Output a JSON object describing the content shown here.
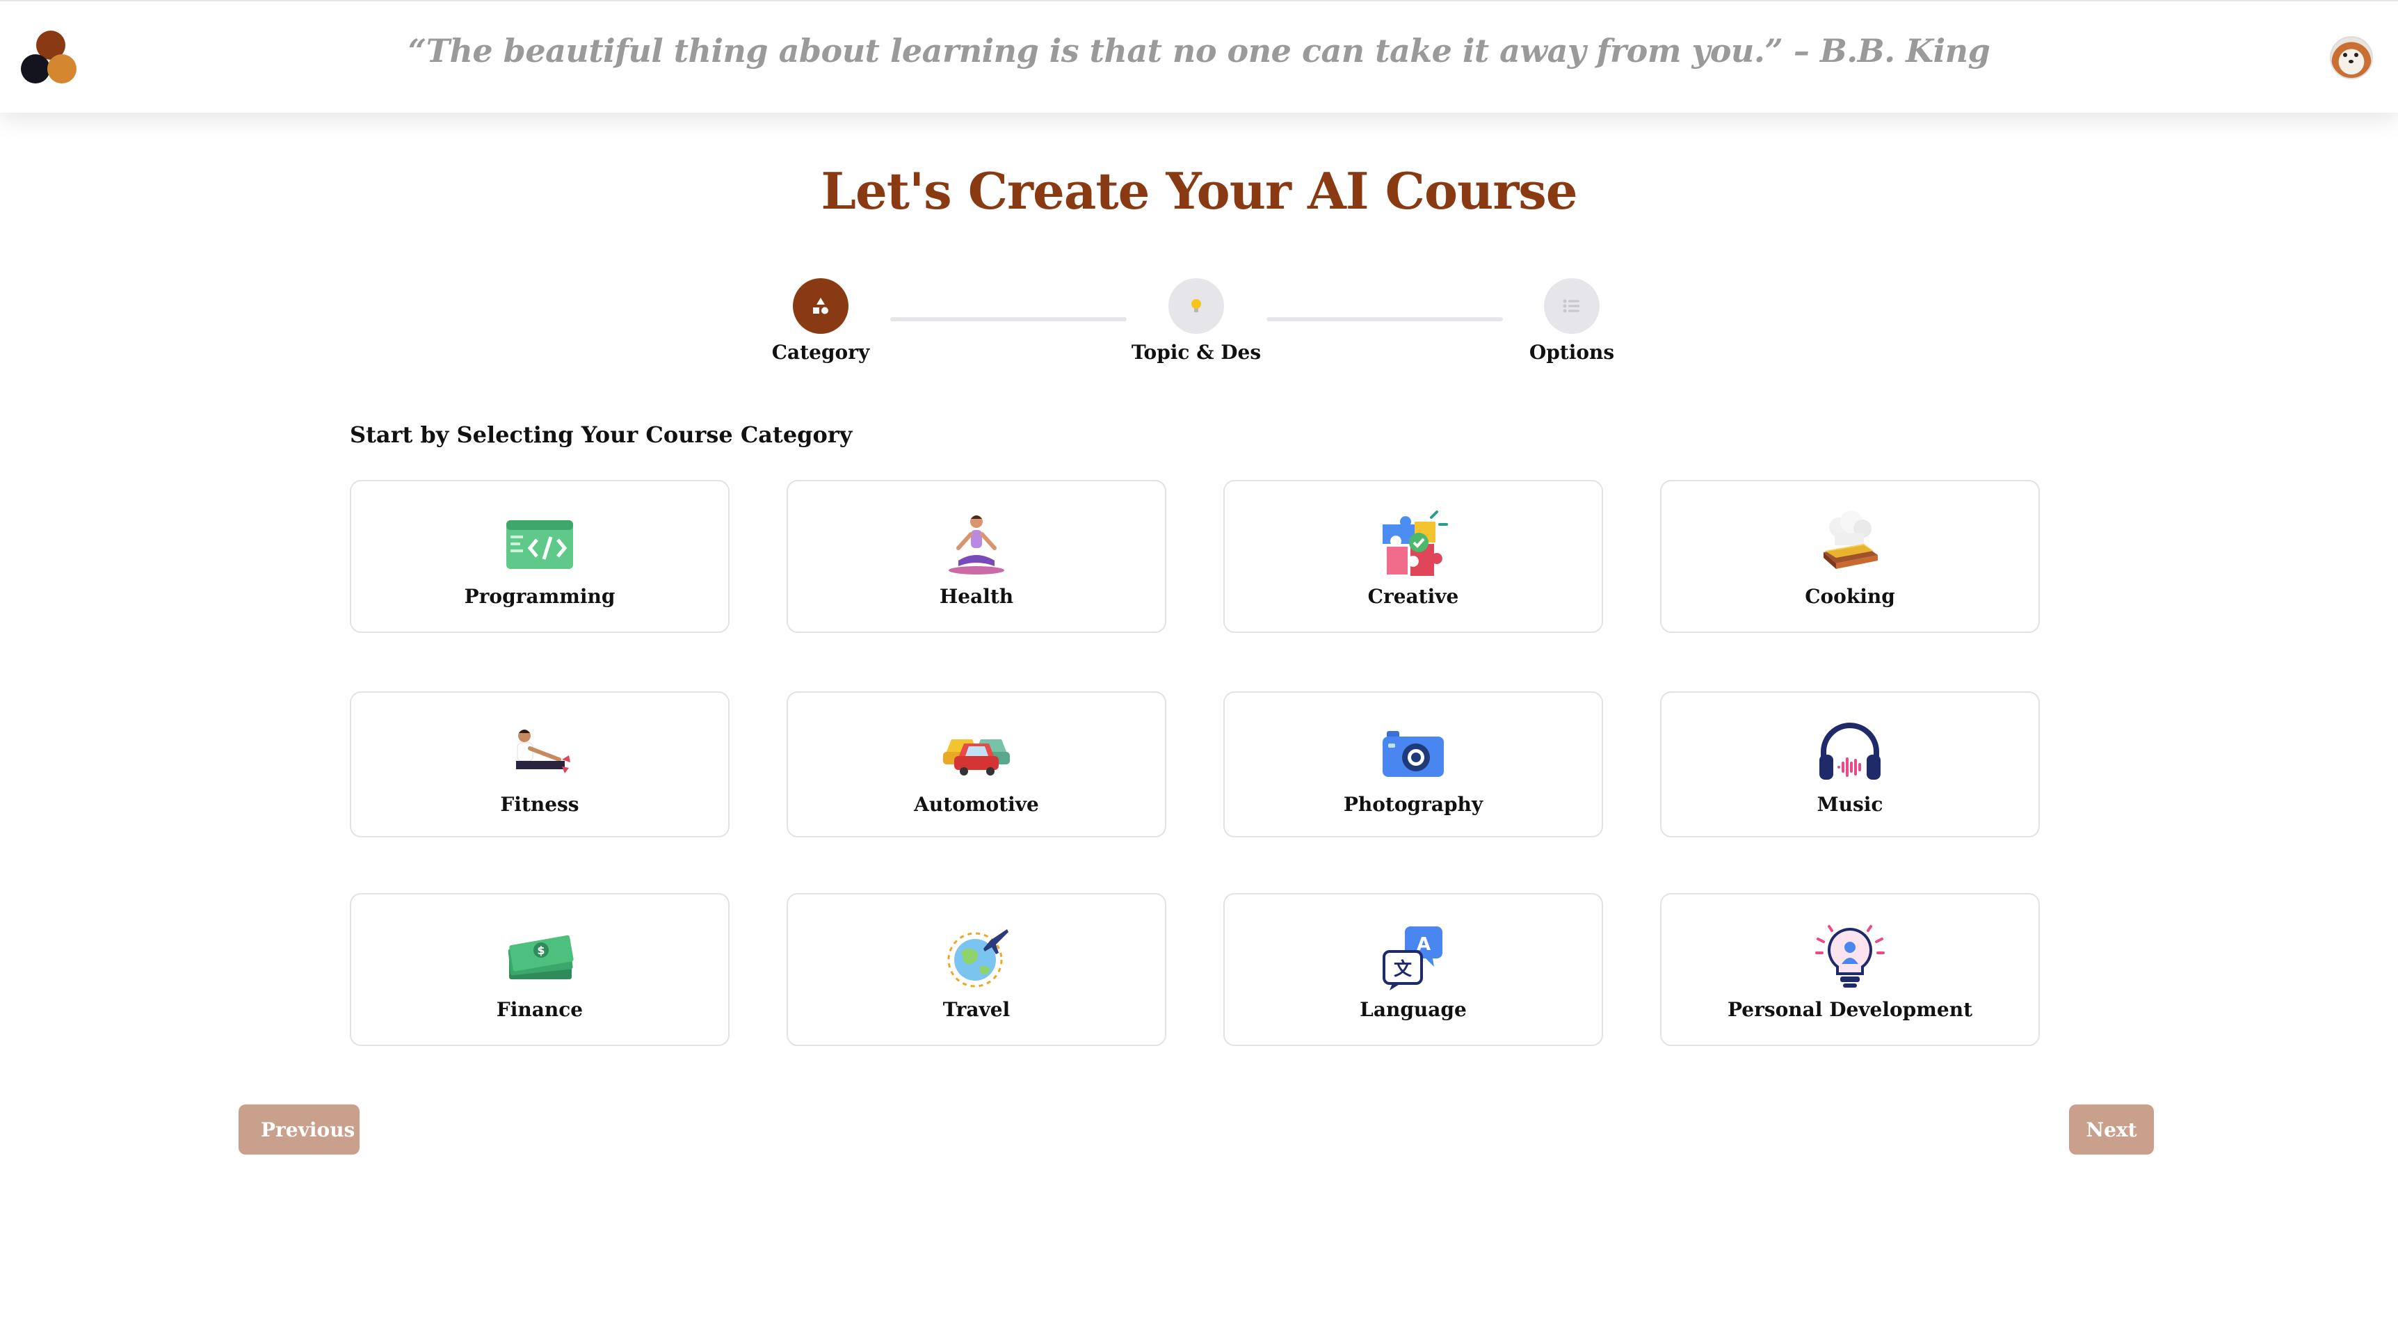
{
  "header": {
    "quote": "“The beautiful thing about learning is that no one can take it away from you.” – B.B. King"
  },
  "page": {
    "title": "Let's Create Your AI Course",
    "section_title": "Start by Selecting Your Course Category"
  },
  "stepper": {
    "steps": [
      {
        "label": "Category",
        "icon": "shapes-icon",
        "active": true
      },
      {
        "label": "Topic & Des",
        "icon": "lightbulb-icon",
        "active": false
      },
      {
        "label": "Options",
        "icon": "list-icon",
        "active": false
      }
    ]
  },
  "categories": [
    {
      "name": "Programming",
      "icon": "code-window-icon"
    },
    {
      "name": "Health",
      "icon": "yoga-person-icon"
    },
    {
      "name": "Creative",
      "icon": "puzzle-icon"
    },
    {
      "name": "Cooking",
      "icon": "chef-hat-icon"
    },
    {
      "name": "Fitness",
      "icon": "stretching-person-icon"
    },
    {
      "name": "Automotive",
      "icon": "cars-icon"
    },
    {
      "name": "Photography",
      "icon": "camera-icon"
    },
    {
      "name": "Music",
      "icon": "headphones-icon"
    },
    {
      "name": "Finance",
      "icon": "money-icon"
    },
    {
      "name": "Travel",
      "icon": "globe-plane-icon"
    },
    {
      "name": "Language",
      "icon": "translate-icon"
    },
    {
      "name": "Personal Development",
      "icon": "lightbulb-person-icon"
    }
  ],
  "buttons": {
    "previous": "Previous",
    "next": "Next"
  },
  "colors": {
    "brand": "#8a3a13",
    "button": "#c9a08c",
    "quote": "#9a9a9a"
  }
}
